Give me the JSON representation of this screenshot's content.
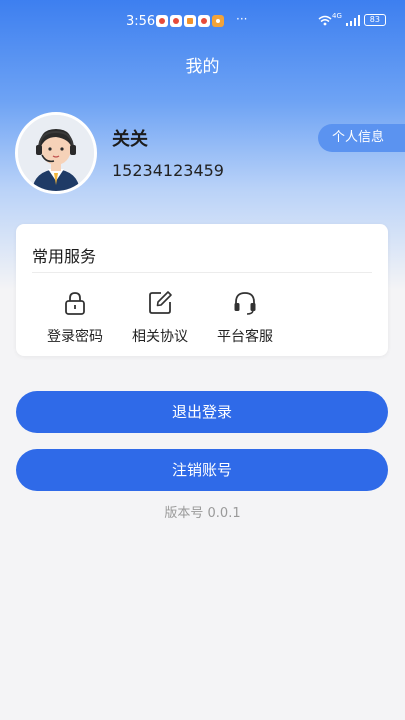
{
  "status_bar": {
    "time": "3:56",
    "more": "···",
    "network": "4G",
    "battery": "83"
  },
  "header": {
    "title": "我的"
  },
  "user": {
    "name": "关关",
    "phone": "15234123459",
    "profile_button": "个人信息"
  },
  "services": {
    "title": "常用服务",
    "items": [
      {
        "label": "登录密码",
        "icon": "lock-icon"
      },
      {
        "label": "相关协议",
        "icon": "edit-icon"
      },
      {
        "label": "平台客服",
        "icon": "headset-icon"
      }
    ]
  },
  "actions": {
    "logout": "退出登录",
    "delete_account": "注销账号"
  },
  "footer": {
    "version": "版本号 0.0.1"
  },
  "colors": {
    "accent": "#2f6ae8",
    "header_top": "#3d7ff0"
  }
}
